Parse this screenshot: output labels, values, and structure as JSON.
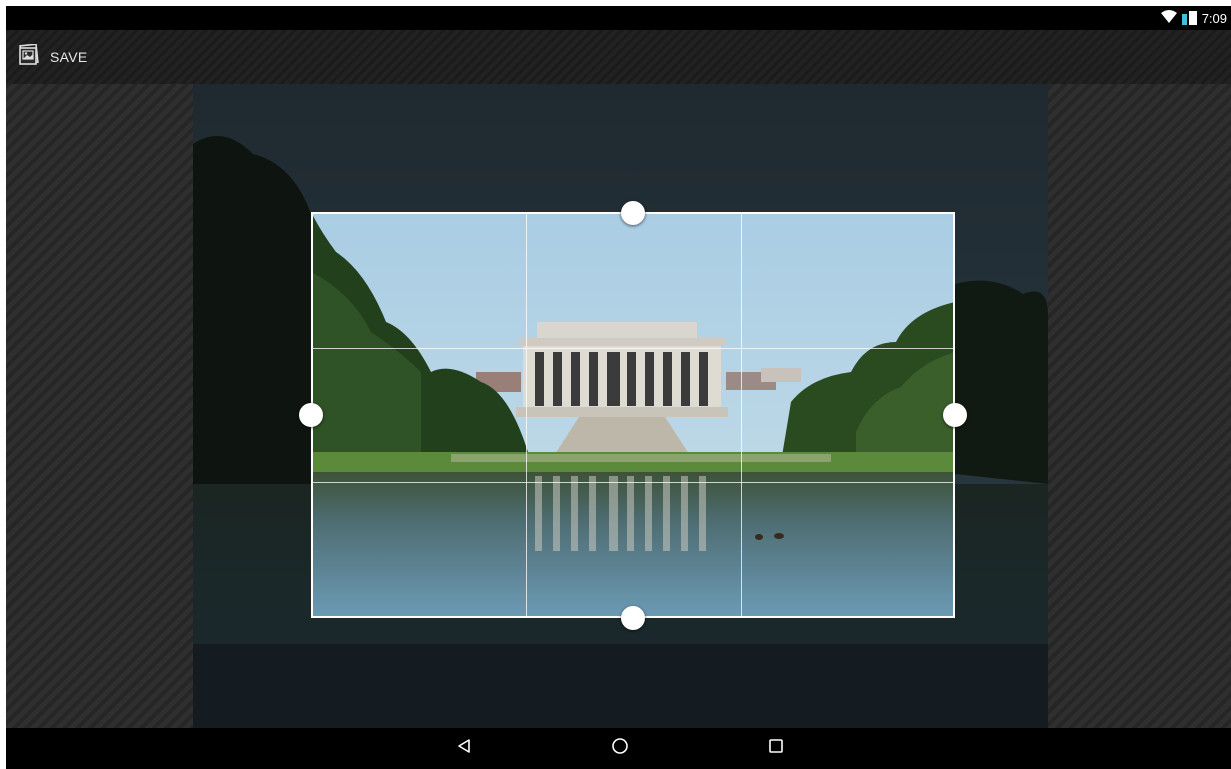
{
  "status_bar": {
    "time": "7:09",
    "icons": [
      "wifi-icon",
      "battery-icon"
    ]
  },
  "action_bar": {
    "save_label": "SAVE",
    "save_icon": "save-photo-icon"
  },
  "crop": {
    "handles": [
      "top",
      "left",
      "right",
      "bottom"
    ],
    "grid": "3x3"
  },
  "nav_bar": {
    "buttons": [
      "back-icon",
      "home-icon",
      "recents-icon"
    ]
  }
}
